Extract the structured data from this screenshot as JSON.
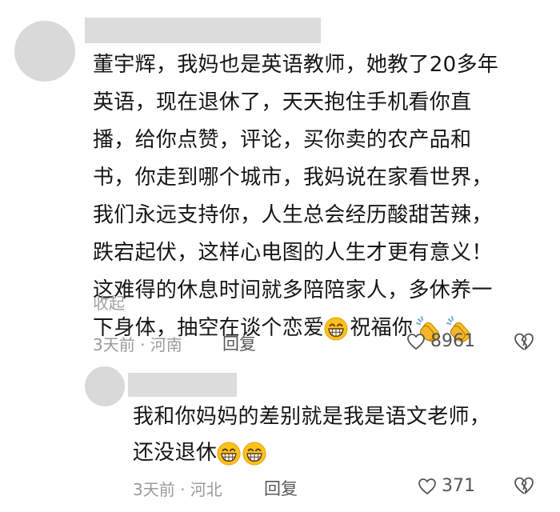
{
  "comment": {
    "lines": [
      "董宇辉，我妈也是英语教师，她教了20多年",
      "英语，现在退休了，天天抱住手机看你直",
      "播，给你点赞，评论，买你卖的农产品和",
      "书，你走到哪个城市，我妈说在家看世界，",
      "我们永远支持你，人生总会经历酸甜苦辣，",
      "跌宕起伏，这样心电图的人生才更有意义！",
      "这难得的休息时间就多陪陪家人，多休养一"
    ],
    "last_line_text": "下身体，抽空在谈个恋爱",
    "last_line_suffix": "祝福你",
    "collapse_label": "收起",
    "time_location": "3天前 · 河南",
    "reply_label": "回复",
    "like_count": "8961",
    "icons": {
      "emoji": "grinning-face-icon",
      "clap": "clapping-hands-icon",
      "like": "heart-icon",
      "dislike": "broken-heart-icon"
    }
  },
  "reply": {
    "line1": "我和你妈妈的差别就是我是语文老师，",
    "line2": "还没退休",
    "time_location": "3天前 · 河北",
    "reply_label": "回复",
    "like_count": "371"
  },
  "colors": {
    "avatar": "#d9d9d9",
    "name_placeholder": "#dcdcdc",
    "meta_text": "#9a9a9a",
    "emoji_yellow": "#fcc21b"
  }
}
